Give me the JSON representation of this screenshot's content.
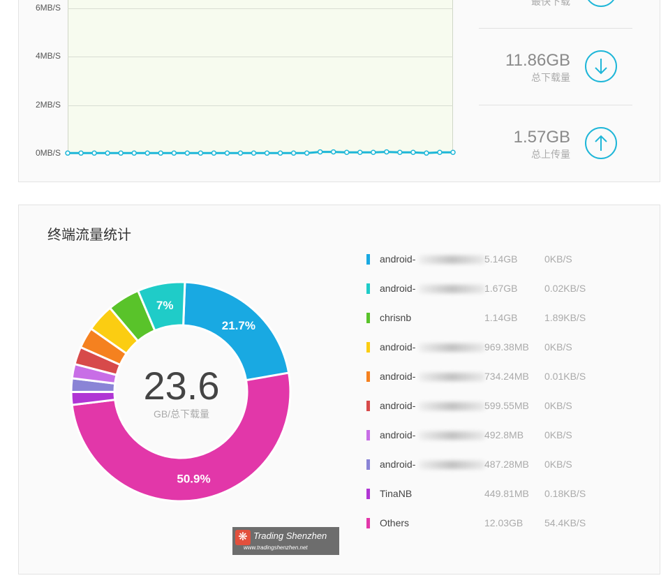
{
  "speed_chart": {
    "y_ticks": [
      "6MB/S",
      "4MB/S",
      "2MB/S",
      "0MB/S"
    ],
    "line_color": "#1eb6d8",
    "bg_color": "#f7fbef"
  },
  "chart_data": {
    "type": "line",
    "xlabel": "",
    "ylabel": "",
    "ylim": [
      0,
      6
    ],
    "y_unit": "MB/S",
    "series": [
      {
        "values": [
          0.02,
          0.02,
          0.02,
          0.02,
          0.02,
          0.02,
          0.02,
          0.02,
          0.02,
          0.02,
          0.02,
          0.02,
          0.02,
          0.02,
          0.02,
          0.02,
          0.02,
          0.02,
          0.02,
          0.07,
          0.07,
          0.05,
          0.05,
          0.05,
          0.07,
          0.05,
          0.05,
          0.02,
          0.05,
          0.05
        ]
      }
    ]
  },
  "stats": {
    "top_label": "最快下载",
    "download_value": "11.86GB",
    "download_label": "总下载量",
    "upload_value": "1.57GB",
    "upload_label": "总上传量"
  },
  "terminal_section": {
    "title": "终端流量统计",
    "center_value": "23.6",
    "center_label": "GB/总下载量"
  },
  "donut_data": {
    "type": "pie",
    "slices": [
      {
        "value": 21.7,
        "color": "#19a9e2",
        "label": "21.7%"
      },
      {
        "value": 50.9,
        "color": "#e237a9",
        "label": "50.9%"
      },
      {
        "value": 1.9,
        "color": "#b035d4",
        "label": ""
      },
      {
        "value": 2.0,
        "color": "#8a84d6",
        "label": ""
      },
      {
        "value": 2.1,
        "color": "#c86ee6",
        "label": ""
      },
      {
        "value": 2.6,
        "color": "#d74a4a",
        "label": ""
      },
      {
        "value": 3.1,
        "color": "#f5811f",
        "label": ""
      },
      {
        "value": 4.1,
        "color": "#fbcd12",
        "label": ""
      },
      {
        "value": 4.8,
        "color": "#59c32a",
        "label": ""
      },
      {
        "value": 7.0,
        "color": "#1fccc8",
        "label": "7%"
      }
    ]
  },
  "legend": [
    {
      "name": "android-",
      "size": "5.14GB",
      "speed": "0KB/S",
      "color": "#19a9e2",
      "blurred": true
    },
    {
      "name": "android-",
      "size": "1.67GB",
      "speed": "0.02KB/S",
      "color": "#1fccc8",
      "blurred": true
    },
    {
      "name": "chrisnb",
      "size": "1.14GB",
      "speed": "1.89KB/S",
      "color": "#59c32a",
      "blurred": false
    },
    {
      "name": "android-",
      "size": "969.38MB",
      "speed": "0KB/S",
      "color": "#fbcd12",
      "blurred": true
    },
    {
      "name": "android-",
      "size": "734.24MB",
      "speed": "0.01KB/S",
      "color": "#f5811f",
      "blurred": true
    },
    {
      "name": "android-",
      "size": "599.55MB",
      "speed": "0KB/S",
      "color": "#d74a4a",
      "blurred": true
    },
    {
      "name": "android-",
      "size": "492.8MB",
      "speed": "0KB/S",
      "color": "#c86ee6",
      "blurred": true
    },
    {
      "name": "android-",
      "size": "487.28MB",
      "speed": "0KB/S",
      "color": "#8a84d6",
      "blurred": true
    },
    {
      "name": "TinaNB",
      "size": "449.81MB",
      "speed": "0.18KB/S",
      "color": "#b035d4",
      "blurred": false
    },
    {
      "name": "Others",
      "size": "12.03GB",
      "speed": "54.4KB/S",
      "color": "#e237a9",
      "blurred": false
    }
  ],
  "watermark": {
    "logo_glyph": "❋",
    "title": "Trading Shenzhen",
    "url": "www.tradingshenzhen.net"
  }
}
